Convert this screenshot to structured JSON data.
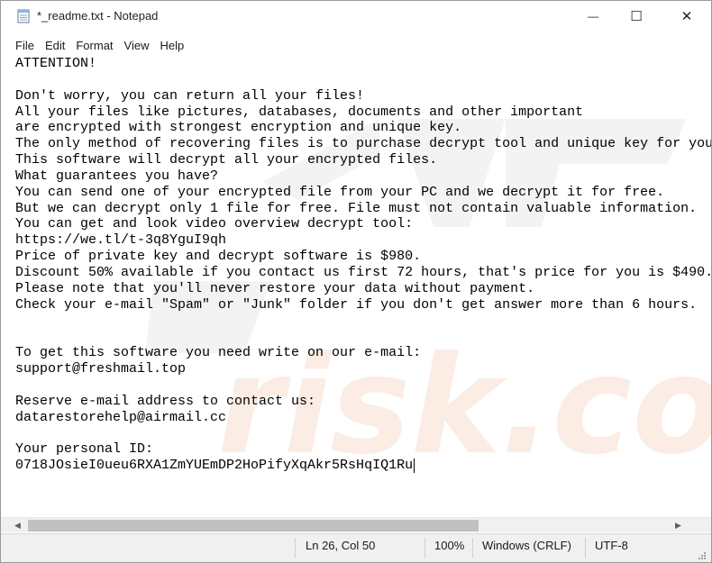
{
  "window": {
    "title": "*_readme.txt - Notepad",
    "minimize_glyph": "—",
    "maximize_glyph": "☐",
    "close_glyph": "✕",
    "app_icon": "notepad-icon"
  },
  "menu": {
    "items": [
      {
        "label": "File"
      },
      {
        "label": "Edit"
      },
      {
        "label": "Format"
      },
      {
        "label": "View"
      },
      {
        "label": "Help"
      }
    ]
  },
  "editor": {
    "content": "ATTENTION!\n\nDon't worry, you can return all your files!\nAll your files like pictures, databases, documents and other important\nare encrypted with strongest encryption and unique key.\nThe only method of recovering files is to purchase decrypt tool and unique key for you.\nThis software will decrypt all your encrypted files.\nWhat guarantees you have?\nYou can send one of your encrypted file from your PC and we decrypt it for free.\nBut we can decrypt only 1 file for free. File must not contain valuable information.\nYou can get and look video overview decrypt tool:\nhttps://we.tl/t-3q8YguI9qh\nPrice of private key and decrypt software is $980.\nDiscount 50% available if you contact us first 72 hours, that's price for you is $490.\nPlease note that you'll never restore your data without payment.\nCheck your e-mail \"Spam\" or \"Junk\" folder if you don't get answer more than 6 hours.\n\n\nTo get this software you need write on our e-mail:\nsupport@freshmail.top\n\nReserve e-mail address to contact us:\ndatarestorehelp@airmail.cc\n\nYour personal ID:\n0718JOsieI0ueu6RXA1ZmYUEmDP2HoPifyXqAkr5RsHqIQ1Ru",
    "watermark_color": "#f4f4f4",
    "watermark_accent": "#fbe8de"
  },
  "status": {
    "position": "Ln 26, Col 50",
    "zoom": "100%",
    "line_ending": "Windows (CRLF)",
    "encoding": "UTF-8"
  },
  "scroll": {
    "left_arrow": "◀",
    "right_arrow": "▶"
  }
}
